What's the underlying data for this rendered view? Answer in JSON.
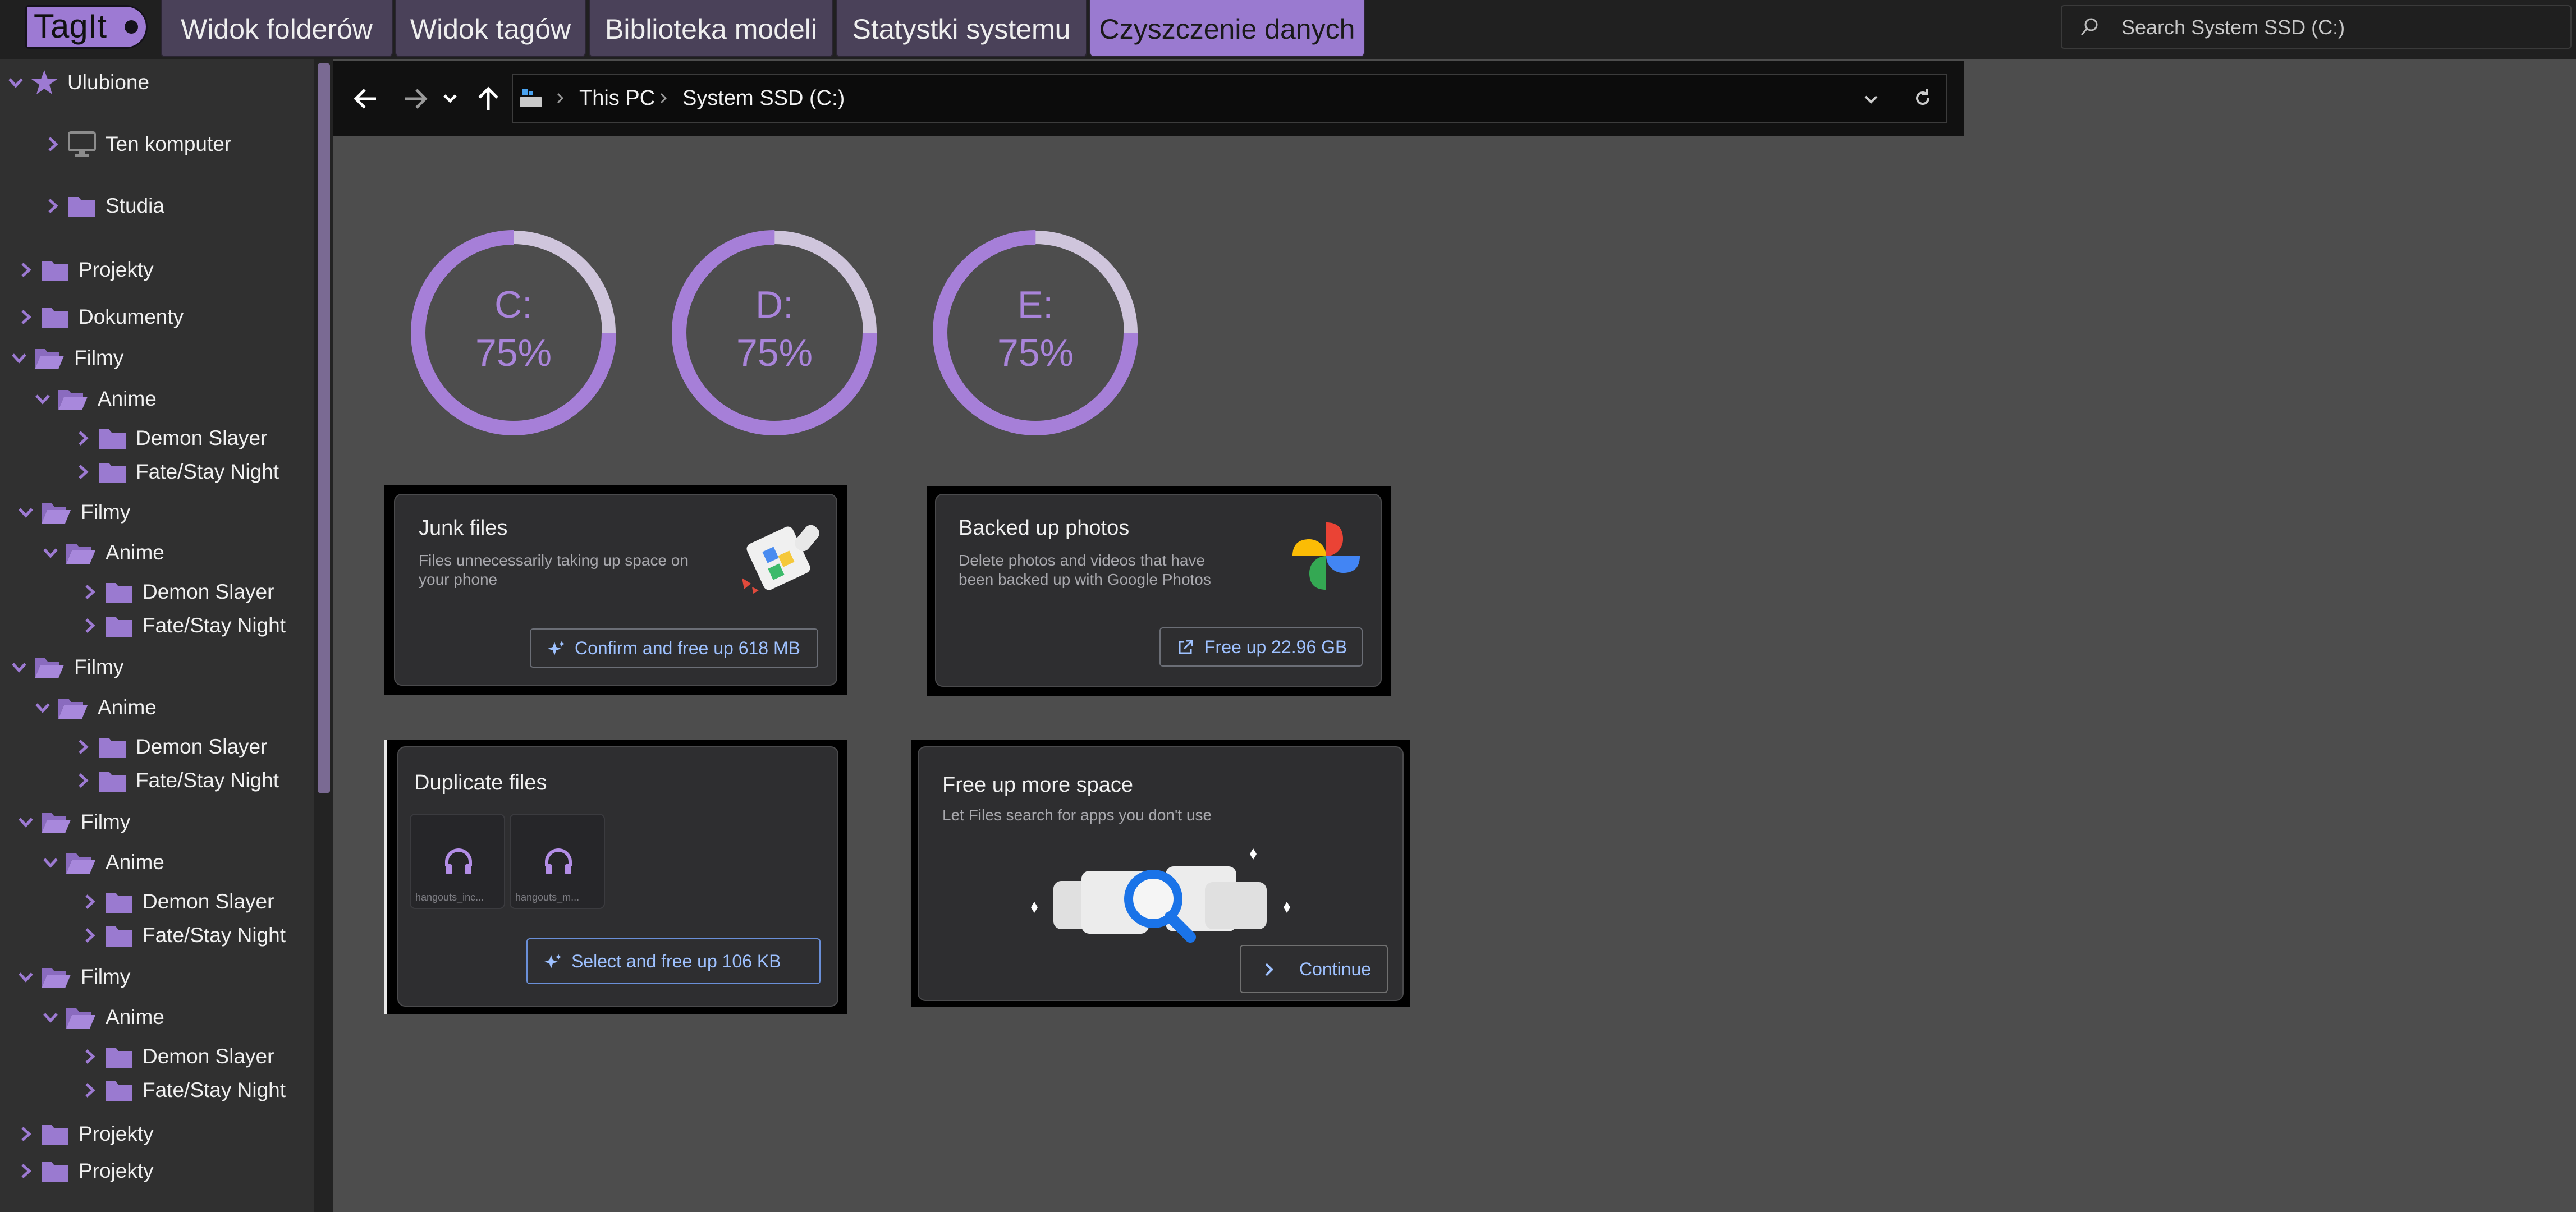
{
  "app": {
    "logo": "TagIt"
  },
  "tabs": [
    {
      "label": "Widok folderów"
    },
    {
      "label": "Widok tagów"
    },
    {
      "label": "Biblioteka modeli"
    },
    {
      "label": "Statystki systemu"
    },
    {
      "label": "Czyszczenie danych",
      "active": true
    }
  ],
  "search": {
    "placeholder": "Search System SSD (C:)"
  },
  "sidebar": {
    "favorites": "Ulubione",
    "computer": "Ten komputer",
    "studia": "Studia",
    "projekty": "Projekty",
    "dokumenty": "Dokumenty",
    "filmy": "Filmy",
    "anime": "Anime",
    "demon": "Demon Slayer",
    "fate": "Fate/Stay Night"
  },
  "breadcrumb": {
    "root": "This PC",
    "drive": "System SSD (C:)"
  },
  "disks": [
    {
      "letter": "C:",
      "percent_label": "75%",
      "usage": 0.75
    },
    {
      "letter": "D:",
      "percent_label": "75%",
      "usage": 0.75
    },
    {
      "letter": "E:",
      "percent_label": "75%",
      "usage": 0.75
    }
  ],
  "cards": {
    "junk": {
      "title": "Junk files",
      "subtitle_1": "Files unnecessarily taking up space on",
      "subtitle_2": "your phone",
      "button": "Confirm and free up 618 MB"
    },
    "photos": {
      "title": "Backed up photos",
      "subtitle_1": "Delete photos and videos that have",
      "subtitle_2": "been backed up with Google Photos",
      "button": "Free up 22.96 GB"
    },
    "duplicates": {
      "title": "Duplicate files",
      "file_1": "hangouts_inc...",
      "file_2": "hangouts_m...",
      "button": "Select and free up 106 KB"
    },
    "more": {
      "title": "Free up more space",
      "subtitle": "Let Files search for apps you don't use",
      "button": "Continue"
    }
  },
  "colors": {
    "accent": "#9d7ad3",
    "ring": "#a67fd8",
    "link": "#9ec1ff"
  }
}
